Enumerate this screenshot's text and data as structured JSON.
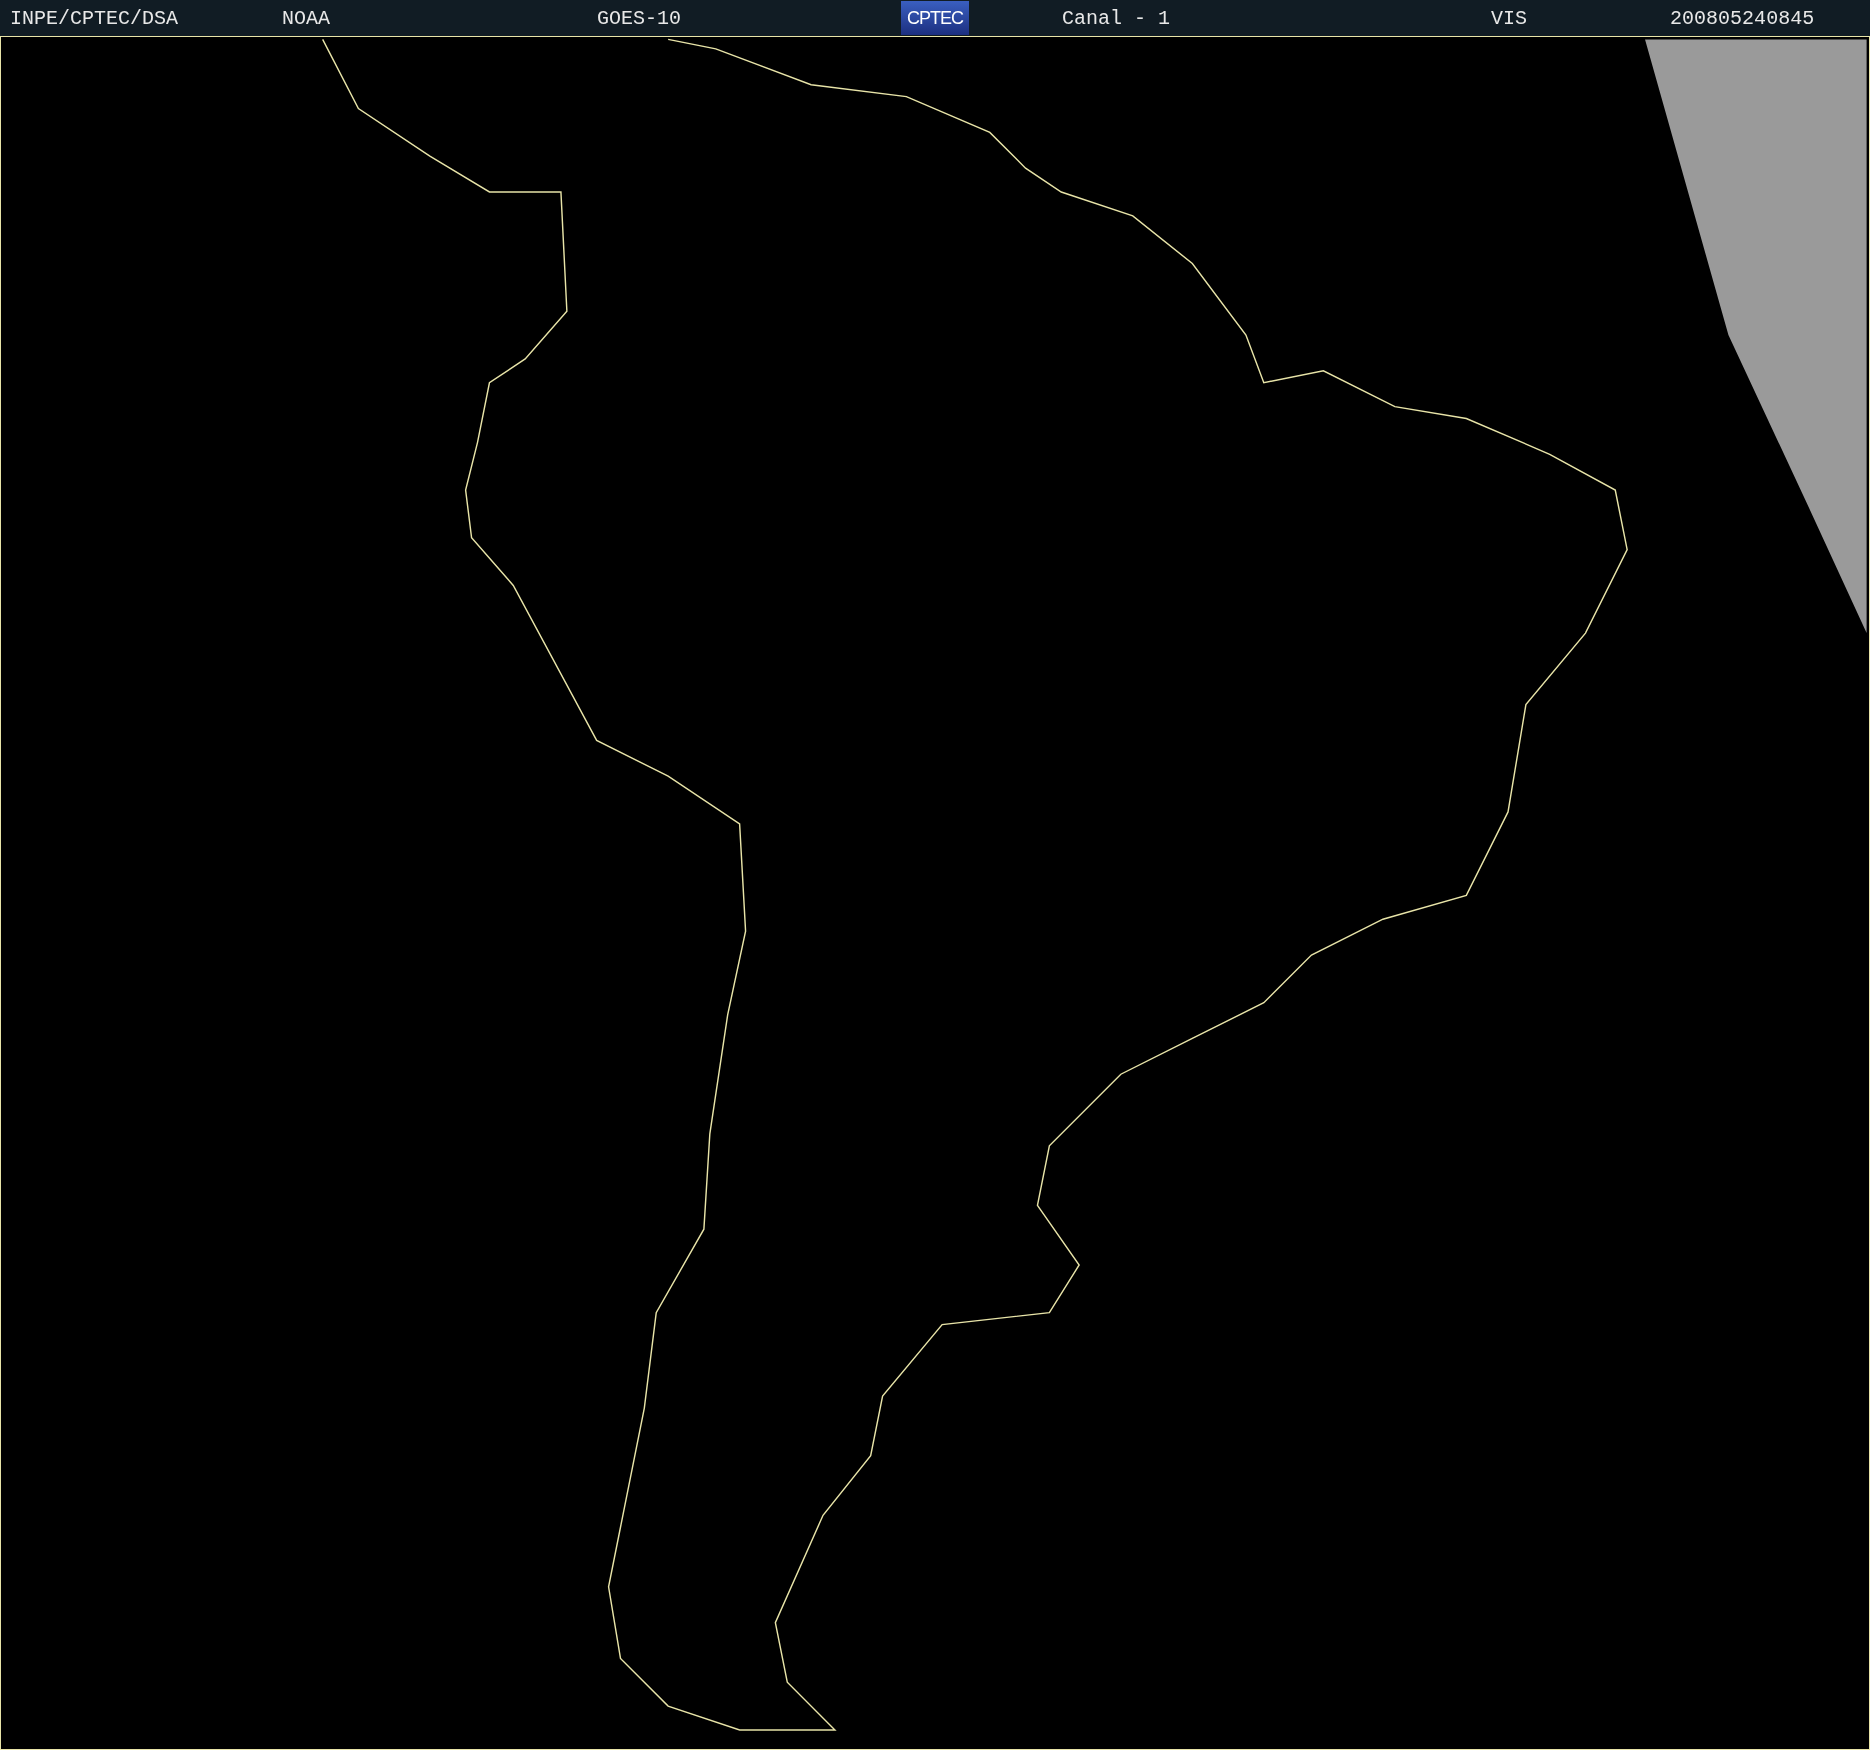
{
  "header": {
    "institution": "INPE/CPTEC/DSA",
    "agency": "NOAA",
    "satellite": "GOES-10",
    "logo": "CPTEC",
    "channel": "Canal - 1",
    "band": "VIS",
    "timestamp": "200805240845"
  }
}
